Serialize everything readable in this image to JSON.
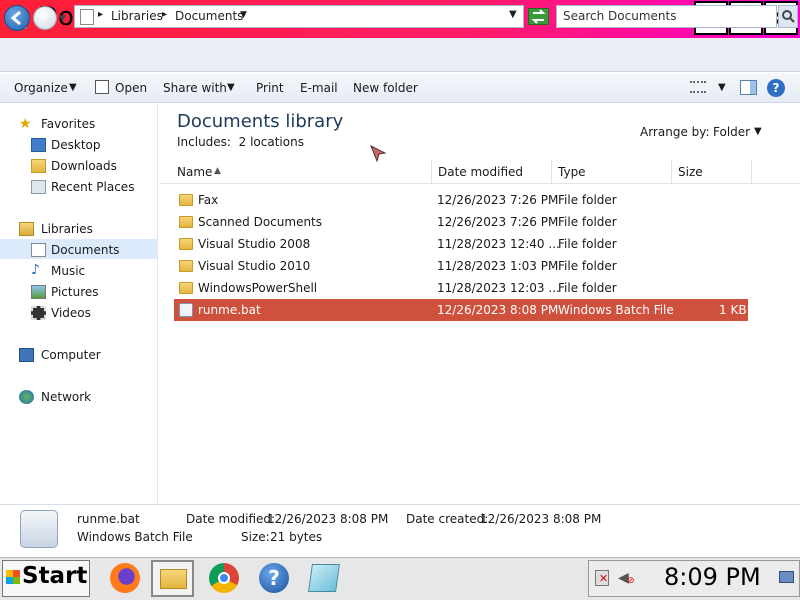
{
  "window": {
    "title": "Documents"
  },
  "address": {
    "crumbs": [
      "Libraries",
      "Documents"
    ],
    "search_placeholder": "Search Documents"
  },
  "toolbar": {
    "organize": "Organize",
    "open": "Open",
    "share_with": "Share with",
    "print": "Print",
    "email": "E-mail",
    "new_folder": "New folder"
  },
  "nav": {
    "favorites": "Favorites",
    "desktop": "Desktop",
    "downloads": "Downloads",
    "recent_places": "Recent Places",
    "libraries": "Libraries",
    "documents": "Documents",
    "music": "Music",
    "pictures": "Pictures",
    "videos": "Videos",
    "computer": "Computer",
    "network": "Network"
  },
  "content": {
    "title": "Documents library",
    "includes_label": "Includes:",
    "includes_value": "2 locations",
    "arrange_label": "Arrange by:",
    "arrange_value": "Folder"
  },
  "columns": {
    "name": "Name",
    "date": "Date modified",
    "type": "Type",
    "size": "Size"
  },
  "files": [
    {
      "name": "Fax",
      "date": "12/26/2023 7:26 PM",
      "type": "File folder",
      "size": ""
    },
    {
      "name": "Scanned Documents",
      "date": "12/26/2023 7:26 PM",
      "type": "File folder",
      "size": ""
    },
    {
      "name": "Visual Studio 2008",
      "date": "11/28/2023 12:40 ...",
      "type": "File folder",
      "size": ""
    },
    {
      "name": "Visual Studio 2010",
      "date": "11/28/2023 1:03 PM",
      "type": "File folder",
      "size": ""
    },
    {
      "name": "WindowsPowerShell",
      "date": "11/28/2023 12:03 ...",
      "type": "File folder",
      "size": ""
    },
    {
      "name": "runme.bat",
      "date": "12/26/2023 8:08 PM",
      "type": "Windows Batch File",
      "size": "1 KB"
    }
  ],
  "details": {
    "name": "runme.bat",
    "type": "Windows Batch File",
    "date_modified_label": "Date modified:",
    "date_modified": "12/26/2023 8:08 PM",
    "date_created_label": "Date created:",
    "date_created": "12/26/2023 8:08 PM",
    "size_label": "Size:",
    "size": "21 bytes"
  },
  "taskbar": {
    "start": "Start",
    "clock": "8:09 PM",
    "icons": [
      "firefox-icon",
      "file-explorer-icon",
      "chrome-icon",
      "help-icon",
      "notepad-icon"
    ]
  },
  "colors": {
    "titlebar_start": "#ff1f35",
    "titlebar_end": "#ff00d0",
    "selection": "#d0503e"
  }
}
